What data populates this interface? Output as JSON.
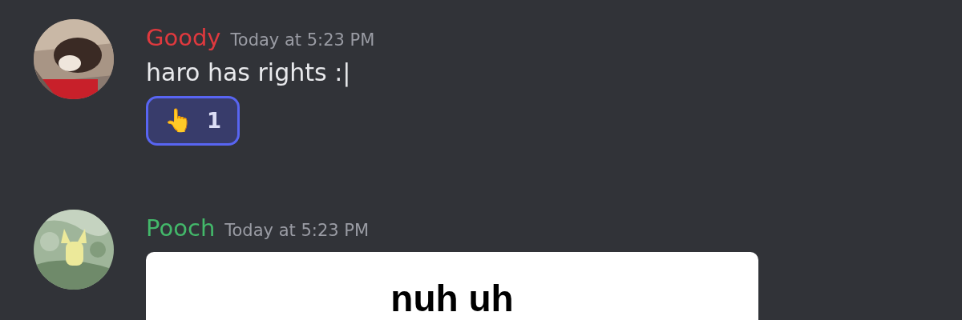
{
  "messages": [
    {
      "author": "Goody",
      "color": "#e0393e",
      "timestamp": "Today at 5:23 PM",
      "text": "haro has rights :|",
      "avatar": {
        "kind": "picture"
      },
      "reactions": [
        {
          "emoji": "👆",
          "count": "1",
          "selected": true
        }
      ]
    },
    {
      "author": "Pooch",
      "color": "#43b86a",
      "timestamp": "Today at 5:23 PM",
      "avatar": {
        "kind": "picture"
      },
      "attachment": {
        "text": "nuh uh"
      }
    }
  ]
}
